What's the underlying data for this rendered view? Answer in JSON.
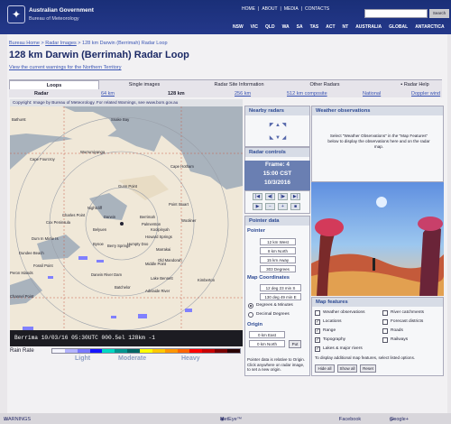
{
  "header": {
    "gov": "Australian Government",
    "bom": "Bureau of Meteorology",
    "links": [
      "HOME",
      "ABOUT",
      "MEDIA",
      "CONTACTS"
    ],
    "search_btn": "Search",
    "states": [
      "NSW",
      "VIC",
      "QLD",
      "WA",
      "SA",
      "TAS",
      "ACT",
      "NT",
      "AUSTRALIA",
      "GLOBAL",
      "ANTARCTICA"
    ]
  },
  "breadcrumb": {
    "home": "Bureau Home",
    "sep": ">",
    "images": "Radar Images",
    "current": "128 km Darwin (Berrimah) Radar Loop"
  },
  "page_title": "128 km Darwin (Berrimah) Radar Loop",
  "warnings_link": "View the current warnings for the Northern Territory",
  "tabs": {
    "loops": "Loops",
    "single": "Single images",
    "site": "Radar Site Information",
    "other": "Other Radars",
    "help": "Radar Help",
    "sub_radar": "Radar",
    "sub_64": "64 km",
    "sub_128": "128 km",
    "sub_256": "256 km",
    "sub_512": "512 km composite",
    "sub_national": "National",
    "sub_doppler": "Doppler wind"
  },
  "radar": {
    "copyright": "Copyright: Image by Bureau of Meteorology. For related Warnings, see www.bom.gov.au",
    "footer": "Berrima 10/03/16 05:30UTC 000.5el 128km -1",
    "rain_rate": "Rain Rate",
    "scale_labels": [
      "Light",
      "Moderate",
      "Heavy"
    ],
    "scale_colors": [
      "#f5f5ff",
      "#b4b4ff",
      "#7878ff",
      "#1414ff",
      "#00d8c3",
      "#009690",
      "#006666",
      "#ffff00",
      "#ffc800",
      "#ff9600",
      "#ff6400",
      "#ff0000",
      "#c80000",
      "#780000",
      "#280000"
    ],
    "places": [
      "Bathurst",
      "Snake Bay",
      "Cape Fourcroy",
      "Wurrumiyanga",
      "Cape Hotham",
      "Point Stuart",
      "Gunn Point",
      "Charles Point",
      "Nightcliff",
      "Darwin",
      "Berrimah",
      "Palmerston",
      "Howard Springs",
      "Koolpinyah",
      "Dum In Mirrie Is",
      "Belyuen",
      "Bynoe",
      "Channel Point",
      "Humpty Doo",
      "Marrakai",
      "Old Mandorah",
      "Middle Point",
      "Darwin River Dam",
      "Lake Bennett",
      "Wooliner",
      "Adelaide River",
      "Kimberton",
      "Peron Islands",
      "Cox Peninsula",
      "Batchelor",
      "Dundee Beach",
      "Fossil Point",
      "Berry Springs"
    ]
  },
  "side": {
    "nearby": "Nearby radars",
    "controls": "Radar controls",
    "frame": "Frame: 4",
    "time": "15:00 CST",
    "date": "10/3/2016",
    "pointer": "Pointer data",
    "pointer_lbl": "Pointer",
    "ptr_vals": [
      "12 km West",
      "8 km North",
      "15 km Away",
      "303 Degrees"
    ],
    "map_coords": "Map Coordinates",
    "coord_vals": [
      "12 deg 23 min S",
      "130 deg 49 min E"
    ],
    "deg_min": "Degrees & Minutes",
    "dec_deg": "Decimal Degrees",
    "origin": "Origin",
    "origin_vals": [
      "0 km East",
      "0 km North"
    ],
    "origin_btn": "Put",
    "help_txt": "Pointer data is relative to Origin. Click anywhere on radar image, to set a new origin."
  },
  "obs": {
    "title": "Weather observations",
    "text": "Select \"Weather Observations\" in the \"Map Features\" below to display the observations here and on the radar map."
  },
  "features": {
    "title": "Map features",
    "left": [
      "Weather observations",
      "Locations",
      "Range",
      "Topography",
      "Lakes & major rivers"
    ],
    "left_checked": [
      false,
      true,
      true,
      true,
      true
    ],
    "right": [
      "River catchments",
      "Forecast districts",
      "Roads",
      "Railways"
    ],
    "note": "To display additional map features, select listed options.",
    "buttons": [
      "Hide all",
      "Show all",
      "Reset"
    ]
  },
  "footer": {
    "warnings": "WARNINGS",
    "meteye": "MetEye™",
    "facebook": "Facebook",
    "google": "Google+"
  }
}
